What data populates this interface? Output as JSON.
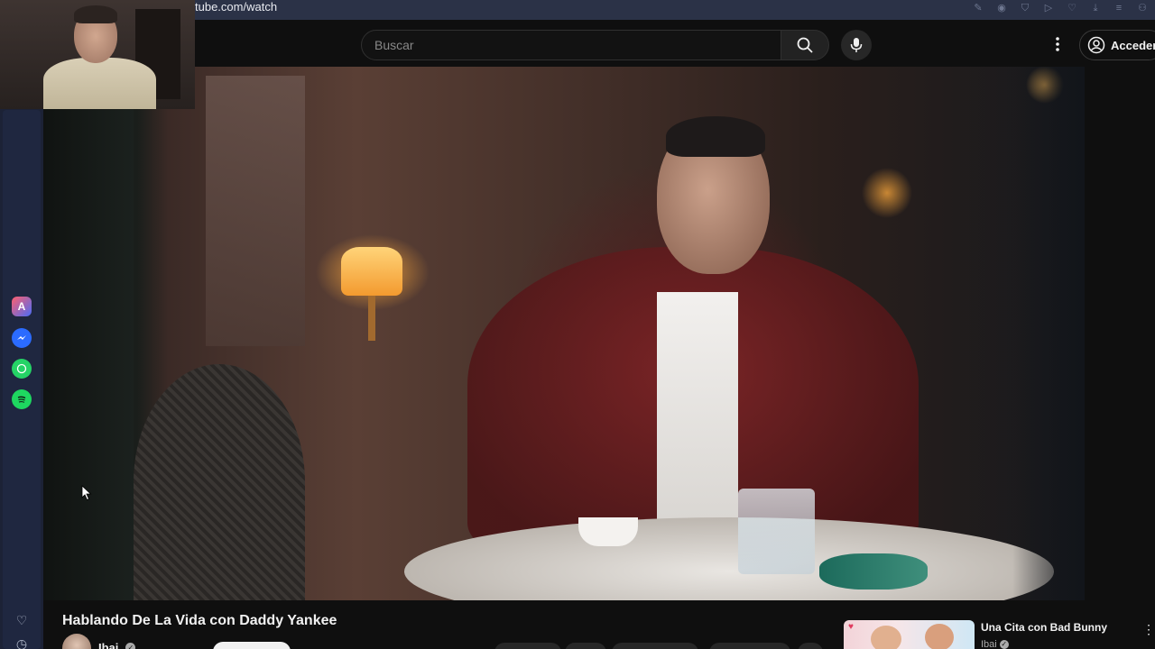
{
  "browser": {
    "url": "tube.com/watch",
    "toolbar_icons": [
      "edit-icon",
      "camera-icon",
      "shield-icon",
      "play-icon",
      "heart-icon",
      "download-icon",
      "menu-icon",
      "user-icon"
    ]
  },
  "sidebar": {
    "apps": [
      {
        "name": "arc-icon"
      },
      {
        "name": "messenger-icon"
      },
      {
        "name": "whatsapp-icon"
      },
      {
        "name": "spotify-icon"
      }
    ],
    "bottom_icons": [
      "heart-icon",
      "history-icon"
    ]
  },
  "header": {
    "search_placeholder": "Buscar",
    "signin_label": "Acceder"
  },
  "video": {
    "title": "Hablando De La Vida con Daddy Yankee",
    "channel": "Ibai"
  },
  "related": [
    {
      "title": "Una Cita con Bad Bunny",
      "channel": "Ibai"
    }
  ],
  "colors": {
    "background": "#0f0f0f",
    "browser_bar": "#2b3247",
    "sidebar": "#1c2236"
  }
}
